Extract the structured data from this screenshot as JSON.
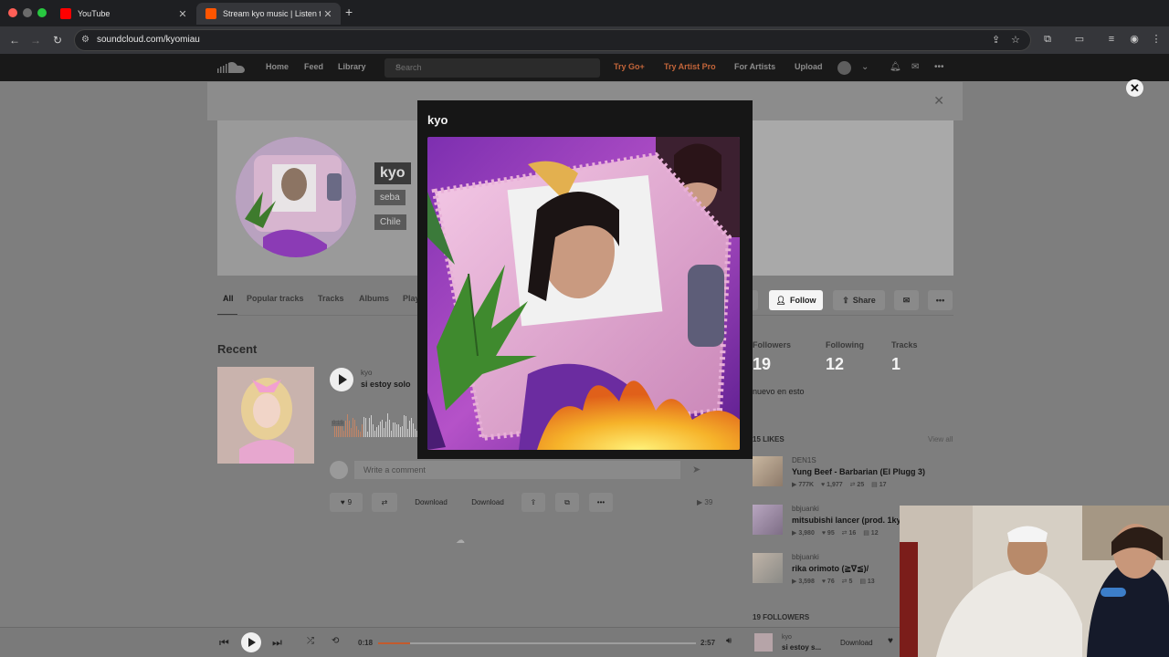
{
  "browser": {
    "tabs": [
      {
        "title": "YouTube",
        "active": false
      },
      {
        "title": "Stream kyo music | Listen to",
        "active": true
      }
    ],
    "url": "soundcloud.com/kyomiau"
  },
  "nav": {
    "home": "Home",
    "feed": "Feed",
    "library": "Library",
    "search_placeholder": "Search",
    "try_go": "Try Go+",
    "try_artist": "Try Artist Pro",
    "for_artists": "For Artists",
    "upload": "Upload"
  },
  "profile": {
    "name": "kyo",
    "subname": "seba",
    "location": "Chile"
  },
  "tabs": [
    "All",
    "Popular tracks",
    "Tracks",
    "Albums",
    "Play"
  ],
  "actions": {
    "follow": "Follow",
    "share": "Share"
  },
  "recent": {
    "heading": "Recent",
    "track_artist": "kyo",
    "track_title": "si estoy solo",
    "waveform_time": "0:15",
    "comment_placeholder": "Write a comment",
    "likes": "9",
    "download1": "Download",
    "download2": "Download",
    "plays": "39"
  },
  "stats": {
    "followers_label": "Followers",
    "followers": "19",
    "following_label": "Following",
    "following": "12",
    "tracks_label": "Tracks",
    "tracks": "1"
  },
  "bio": "nuevo en esto",
  "likes_section": {
    "heading": "15 LIKES",
    "view_all": "View all",
    "items": [
      {
        "user": "DEN1S",
        "title": "Yung Beef - Barbarian (El Plugg 3)",
        "plays": "777K",
        "likes": "1,977",
        "reposts": "25",
        "comments": "17"
      },
      {
        "user": "bbjuanki",
        "title": "mitsubishi lancer (prod. 1kyo)",
        "plays": "3,980",
        "likes": "95",
        "reposts": "16",
        "comments": "12"
      },
      {
        "user": "bbjuanki",
        "title": "rika orimoto (≧∇≦)/",
        "plays": "3,598",
        "likes": "76",
        "reposts": "5",
        "comments": "13"
      }
    ]
  },
  "followers_heading": "19 FOLLOWERS",
  "player": {
    "elapsed": "0:18",
    "duration": "2:57",
    "progress": 0.1,
    "artist": "kyo",
    "title": "si estoy s...",
    "download": "Download"
  },
  "modal": {
    "title": "kyo"
  },
  "colors": {
    "accent": "#ff5500",
    "nav_bg": "#191919"
  }
}
